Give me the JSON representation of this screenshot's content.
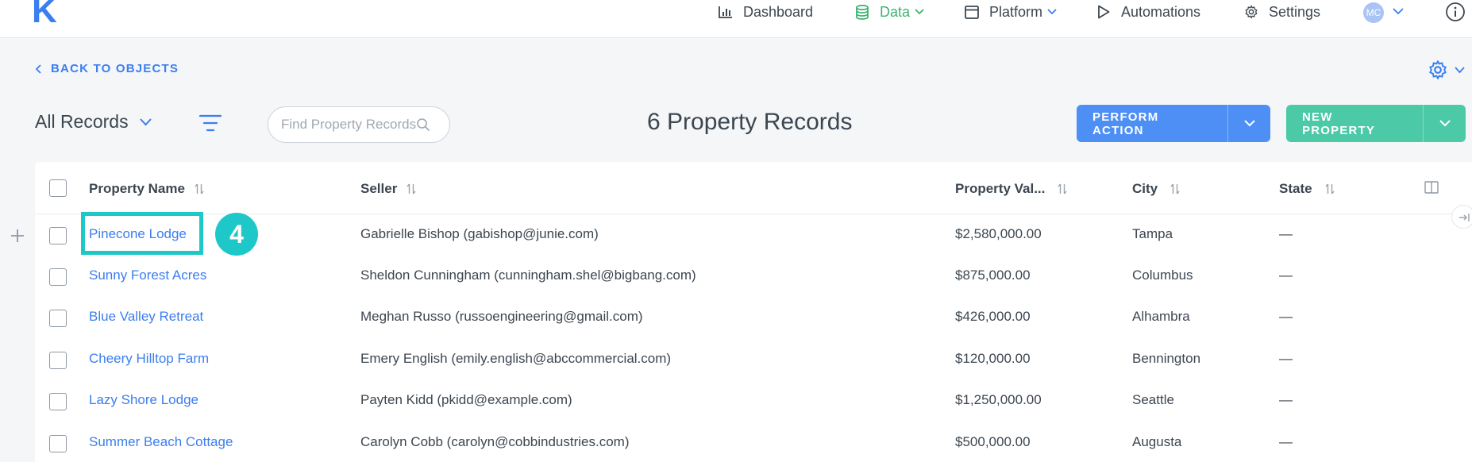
{
  "app": {
    "logo": "K"
  },
  "nav": {
    "items": [
      {
        "label": "Dashboard",
        "icon": "bar-chart-icon"
      },
      {
        "label": "Data",
        "icon": "database-icon",
        "active": true
      },
      {
        "label": "Platform",
        "icon": "calendar-icon"
      },
      {
        "label": "Automations",
        "icon": "play-icon"
      },
      {
        "label": "Settings",
        "icon": "gear-icon"
      }
    ],
    "avatar_initials": "MC"
  },
  "subheader": {
    "back_label": "BACK TO OBJECTS"
  },
  "toolbar": {
    "view_label": "All Records",
    "search_placeholder": "Find Property Records",
    "record_count": "6 Property Records",
    "perform_action_label": "PERFORM ACTION",
    "new_property_label": "NEW PROPERTY"
  },
  "table": {
    "columns": [
      "Property Name",
      "Seller",
      "Property Val...",
      "City",
      "State"
    ],
    "rows": [
      {
        "name": "Pinecone Lodge",
        "seller": "Gabrielle Bishop (gabishop@junie.com)",
        "value": "$2,580,000.00",
        "city": "Tampa",
        "state": "—"
      },
      {
        "name": "Sunny Forest Acres",
        "seller": "Sheldon Cunningham (cunningham.shel@bigbang.com)",
        "value": "$875,000.00",
        "city": "Columbus",
        "state": "—"
      },
      {
        "name": "Blue Valley Retreat",
        "seller": "Meghan Russo (russoengineering@gmail.com)",
        "value": "$426,000.00",
        "city": "Alhambra",
        "state": "—"
      },
      {
        "name": "Cheery Hilltop Farm",
        "seller": "Emery English (emily.english@abccommercial.com)",
        "value": "$120,000.00",
        "city": "Bennington",
        "state": "—"
      },
      {
        "name": "Lazy Shore Lodge",
        "seller": "Payten Kidd (pkidd@example.com)",
        "value": "$1,250,000.00",
        "city": "Seattle",
        "state": "—"
      },
      {
        "name": "Summer Beach Cottage",
        "seller": "Carolyn Cobb (carolyn@cobbindustries.com)",
        "value": "$500,000.00",
        "city": "Augusta",
        "state": "—"
      }
    ]
  },
  "annotation": {
    "step": "4"
  },
  "colors": {
    "accent": "#3b7ef0",
    "active_nav": "#3cb371",
    "perform_btn": "#4d8ff5",
    "new_btn": "#4cc9a7",
    "highlight": "#1ec8c8"
  }
}
